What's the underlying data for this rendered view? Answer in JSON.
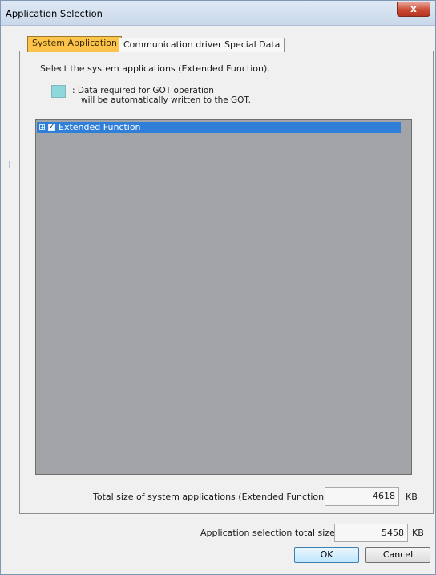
{
  "window": {
    "title": "Application Selection",
    "close_glyph": "x"
  },
  "tabs": [
    {
      "label": "System Application",
      "active": true
    },
    {
      "label": "Communication driver",
      "active": false
    },
    {
      "label": "Special Data",
      "active": false
    }
  ],
  "description": "Select the system applications (Extended Function).",
  "legend": {
    "line1": ": Data required for GOT operation",
    "line2": "will be automatically written to the GOT.",
    "swatch_color": "#8ed7db"
  },
  "tree": {
    "items": [
      {
        "label": "Extended Function",
        "checked": true,
        "expand_glyph": "+",
        "check_glyph": "✓"
      }
    ]
  },
  "totals": {
    "system_label": "Total size of system applications (Extended Function):",
    "system_value": "4618",
    "system_unit": "KB",
    "app_label": "Application selection total size:",
    "app_value": "5458",
    "app_unit": "KB"
  },
  "buttons": {
    "ok": "OK",
    "cancel": "Cancel"
  }
}
